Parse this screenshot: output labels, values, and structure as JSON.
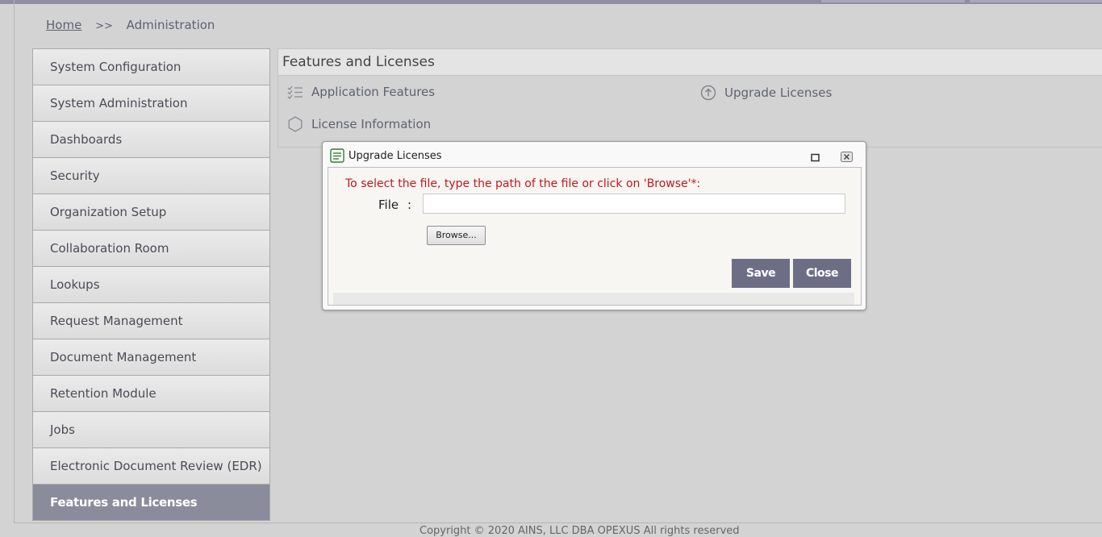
{
  "breadcrumb": {
    "home": "Home",
    "separator": ">>",
    "current": "Administration"
  },
  "sidebar": {
    "items": [
      {
        "label": "System Configuration"
      },
      {
        "label": "System Administration"
      },
      {
        "label": "Dashboards"
      },
      {
        "label": "Security"
      },
      {
        "label": "Organization Setup"
      },
      {
        "label": "Collaboration Room"
      },
      {
        "label": "Lookups"
      },
      {
        "label": "Request Management"
      },
      {
        "label": "Document Management"
      },
      {
        "label": "Retention Module"
      },
      {
        "label": "Jobs"
      },
      {
        "label": "Electronic Document Review (EDR)"
      },
      {
        "label": "Features and Licenses",
        "active": true
      }
    ]
  },
  "panel": {
    "title": "Features and Licenses",
    "features": [
      {
        "label": "Application Features",
        "icon": "checklist-icon"
      },
      {
        "label": "Upgrade Licenses",
        "icon": "upload-circle-icon"
      },
      {
        "label": "License Information",
        "icon": "hexagon-icon"
      }
    ]
  },
  "dialog": {
    "title": "Upgrade Licenses",
    "instruction": "To select the file, type the path of the file or click on 'Browse'*:",
    "file_label": "File",
    "file_colon": ":",
    "file_value": "",
    "browse_label": "Browse...",
    "save_label": "Save",
    "close_label": "Close"
  },
  "footer": {
    "copyright": "Copyright © 2020 AINS, LLC DBA OPEXUS All rights reserved"
  },
  "colors": {
    "accent": "#6d6e86",
    "active_nav": "#8a8b9b",
    "instruction": "#c4161c"
  }
}
